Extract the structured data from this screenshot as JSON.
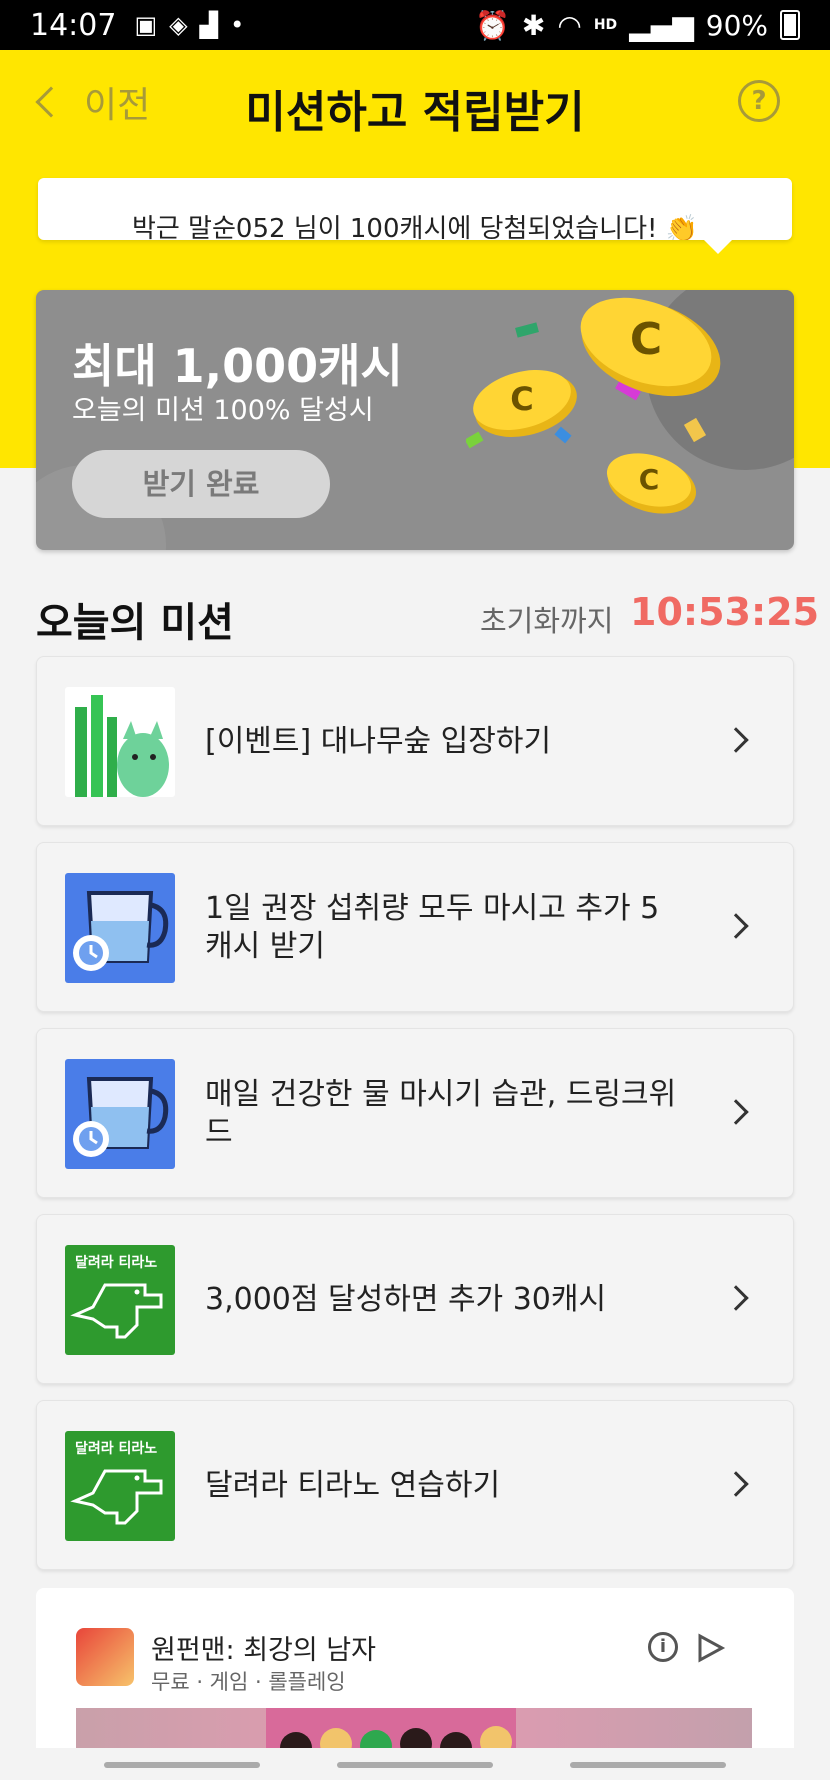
{
  "status_bar": {
    "time": "14:07",
    "battery": "90%",
    "hd_label": "HD"
  },
  "nav": {
    "back_label": "이전",
    "title": "미션하고 적립받기",
    "help_label": "?"
  },
  "banner": {
    "text": "박근 말순052 님이 100캐시에 당첨되었습니다! 👏"
  },
  "reward": {
    "title": "최대 1,000캐시",
    "subtitle": "오늘의 미션 100% 달성시",
    "button_label": "받기 완료"
  },
  "today": {
    "title": "오늘의 미션",
    "reset_label": "초기화까지",
    "reset_time": "10:53:25"
  },
  "missions": [
    {
      "label": "[이벤트] 대나무숲 입장하기",
      "icon": "bamboo-character-icon"
    },
    {
      "label": "1일 권장 섭취량 모두 마시고 추가 5캐시 받기",
      "icon": "water-cup-icon"
    },
    {
      "label": "매일 건강한 물 마시기 습관, 드링크위드",
      "icon": "water-cup-icon"
    },
    {
      "label": "3,000점 달성하면 추가 30캐시",
      "icon": "dino-game-icon",
      "thumb_text": "달려라 티라노"
    },
    {
      "label": "달려라 티라노 연습하기",
      "icon": "dino-game-icon",
      "thumb_text": "달려라 티라노"
    }
  ],
  "ad": {
    "title": "원펀맨: 최강의 남자",
    "meta": "무료 · 게임 · 롤플레잉",
    "info_label": "i"
  },
  "colors": {
    "header_yellow": "#ffe600",
    "reset_time_red": "#f06a63",
    "card_gray": "#8e8e8e",
    "water_blue": "#4a7de8",
    "dino_green": "#2e9a2e"
  }
}
